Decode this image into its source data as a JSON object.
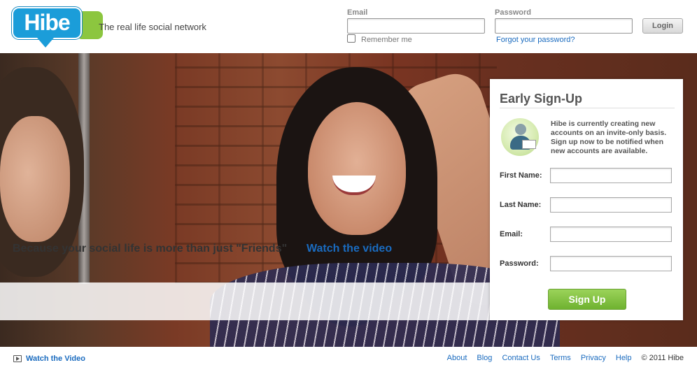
{
  "header": {
    "logo_text": "Hibe",
    "tagline": "The real life social network",
    "email_label": "Email",
    "email_value": "",
    "password_label": "Password",
    "password_value": "",
    "remember_label": "Remember me",
    "forgot_link": "Forgot your password?",
    "login_button": "Login"
  },
  "hero": {
    "banner_text": "Because your social life is more than just \"Friends\"",
    "banner_link": "Watch the video"
  },
  "signup": {
    "title": "Early Sign-Up",
    "description": "Hibe is currently creating new accounts on an invite-only basis. Sign up now to be notified when new accounts are available.",
    "fields": [
      {
        "label": "First Name:",
        "value": ""
      },
      {
        "label": "Last Name:",
        "value": ""
      },
      {
        "label": "Email:",
        "value": ""
      },
      {
        "label": "Password:",
        "value": ""
      }
    ],
    "button": "Sign Up"
  },
  "footer": {
    "video_link": "Watch the Video",
    "links": [
      "About",
      "Blog",
      "Contact Us",
      "Terms",
      "Privacy",
      "Help"
    ],
    "copyright": "© 2011 Hibe"
  },
  "colors": {
    "brand_blue": "#1b9dd9",
    "brand_green": "#8cc63f",
    "link": "#1a6bbf",
    "signup_button": "#7dbf3c"
  },
  "icons": [
    "video-icon",
    "user-mail-icon"
  ]
}
